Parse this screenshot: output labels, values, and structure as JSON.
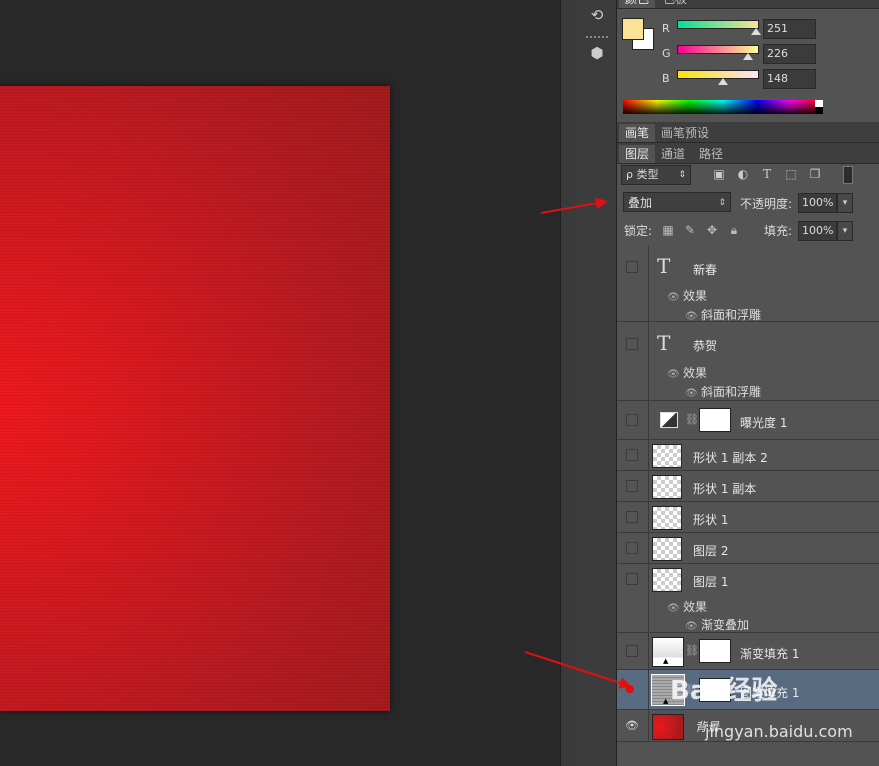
{
  "color_panel": {
    "tabs": [
      "颜色",
      "色板"
    ],
    "channels": [
      {
        "label": "R",
        "value": "251",
        "level": 0.98
      },
      {
        "label": "G",
        "value": "226",
        "level": 0.89
      },
      {
        "label": "B",
        "value": "148",
        "level": 0.58
      }
    ],
    "foreground_color": "#fbe294",
    "background_color": "#ffffff"
  },
  "brush_tabs": [
    "画笔",
    "画笔预设"
  ],
  "layer_tabs": [
    "图层",
    "通道",
    "路径"
  ],
  "filter": {
    "label": "ρ 类型",
    "icons": [
      "image-filter-icon",
      "adjustment-filter-icon",
      "type-filter-icon",
      "shape-filter-icon",
      "smart-object-filter-icon"
    ]
  },
  "blend": {
    "mode": "叠加",
    "opacity_label": "不透明度:",
    "opacity": "100%"
  },
  "lock": {
    "label": "锁定:",
    "fill_label": "填充:",
    "fill": "100%"
  },
  "layers": [
    {
      "name": "新春",
      "kind": "text",
      "visible": false,
      "effects_label": "效果",
      "effects": [
        "斜面和浮雕"
      ]
    },
    {
      "name": "恭贺",
      "kind": "text",
      "visible": false,
      "effects_label": "效果",
      "effects": [
        "斜面和浮雕"
      ]
    },
    {
      "name": "曝光度 1",
      "kind": "adjustment",
      "visible": false
    },
    {
      "name": "形状 1 副本 2",
      "kind": "shape",
      "visible": false
    },
    {
      "name": "形状 1 副本",
      "kind": "shape",
      "visible": false
    },
    {
      "name": "形状 1",
      "kind": "shape",
      "visible": false
    },
    {
      "name": "图层 2",
      "kind": "pixel",
      "visible": false
    },
    {
      "name": "图层 1",
      "kind": "pixel",
      "visible": false,
      "effects_label": "效果",
      "effects": [
        "渐变叠加"
      ]
    },
    {
      "name": "渐变填充 1",
      "kind": "fill",
      "visible": false
    },
    {
      "name": "图案填充 1",
      "kind": "fill",
      "visible": true,
      "selected": true
    },
    {
      "name": "背景",
      "kind": "background",
      "visible": true
    }
  ],
  "watermark": {
    "brand": "Bai 经验",
    "url": "jingyan.baidu.com"
  },
  "colors": {
    "canvas_red": "#d51a1f",
    "arrow": "#e01010",
    "selected_row": "#596b80"
  }
}
